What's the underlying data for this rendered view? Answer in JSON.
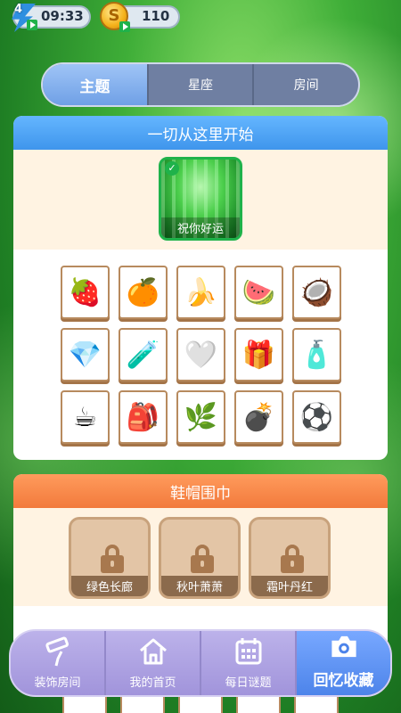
{
  "status": {
    "energy_count": "4",
    "energy_timer": "09:33",
    "coin_symbol": "S",
    "coin_count": "110"
  },
  "tabs": [
    {
      "label": "主题",
      "active": true
    },
    {
      "label": "星座",
      "active": false
    },
    {
      "label": "房间",
      "active": false
    }
  ],
  "section1": {
    "title": "一切从这里开始",
    "theme_card_label": "祝你好运",
    "theme_card_checked": "✓",
    "items": [
      {
        "icon": "strawberry-icon",
        "glyph": "🍓"
      },
      {
        "icon": "orange-icon",
        "glyph": "🍊"
      },
      {
        "icon": "banana-icon",
        "glyph": "🍌"
      },
      {
        "icon": "watermelon-icon",
        "glyph": "🍉"
      },
      {
        "icon": "coconut-icon",
        "glyph": "🥥"
      },
      {
        "icon": "gem-icon",
        "glyph": "💎"
      },
      {
        "icon": "thermos-icon",
        "glyph": "🧪"
      },
      {
        "icon": "heart-pendant-icon",
        "glyph": "🤍"
      },
      {
        "icon": "gift-box-icon",
        "glyph": "🎁"
      },
      {
        "icon": "potion-bottle-icon",
        "glyph": "🧴"
      },
      {
        "icon": "travel-mug-icon",
        "glyph": "☕"
      },
      {
        "icon": "backpack-icon",
        "glyph": "🎒"
      },
      {
        "icon": "leaf-plant-icon",
        "glyph": "🌿"
      },
      {
        "icon": "bomb-icon",
        "glyph": "💣"
      },
      {
        "icon": "beach-ball-icon",
        "glyph": "⚽"
      }
    ]
  },
  "section2": {
    "title": "鞋帽围巾",
    "locked_themes": [
      {
        "label": "绿色长廊"
      },
      {
        "label": "秋叶萧萧"
      },
      {
        "label": "霜叶丹红"
      }
    ]
  },
  "bottom_nav": [
    {
      "label": "装饰房间",
      "icon": "paint-roller-icon",
      "active": false
    },
    {
      "label": "我的首页",
      "icon": "home-icon",
      "active": false
    },
    {
      "label": "每日谜题",
      "icon": "calendar-icon",
      "active": false
    },
    {
      "label": "回忆收藏",
      "icon": "camera-icon",
      "active": true
    }
  ],
  "colors": {
    "section1_header": "#3f95ec",
    "section2_header": "#f27a3c",
    "selected_border": "#1fb24a",
    "nav_active": "#4d84ea"
  }
}
